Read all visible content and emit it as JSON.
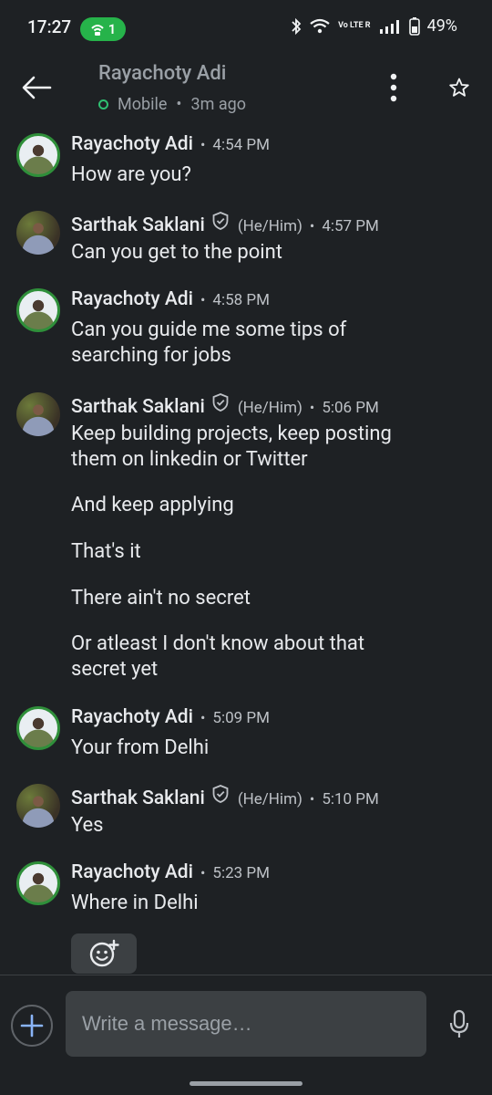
{
  "status_bar": {
    "time": "17:27",
    "hotspot_count": "1",
    "battery": "49%",
    "network_label": "Vo LTE R"
  },
  "header": {
    "contact_name": "Rayachoty Adi",
    "presence": "Mobile",
    "last_seen": "3m ago"
  },
  "messages": [
    {
      "sender": "Rayachoty Adi",
      "time": "4:54 PM",
      "lines": [
        "How are you?"
      ]
    },
    {
      "sender": "Sarthak Saklani",
      "pronouns": "(He/Him)",
      "time": "4:57 PM",
      "lines": [
        "Can you get to the point"
      ]
    },
    {
      "sender": "Rayachoty Adi",
      "time": "4:58 PM",
      "lines": [
        "Can you guide me some tips of searching for jobs"
      ]
    },
    {
      "sender": "Sarthak Saklani",
      "pronouns": "(He/Him)",
      "time": "5:06 PM",
      "lines": [
        "Keep building projects, keep posting them on linkedin or Twitter",
        "And keep applying",
        "That's it",
        "There ain't no secret",
        "Or atleast I don't know about that secret yet"
      ]
    },
    {
      "sender": "Rayachoty Adi",
      "time": "5:09 PM",
      "lines": [
        "Your from Delhi"
      ]
    },
    {
      "sender": "Sarthak Saklani",
      "pronouns": "(He/Him)",
      "time": "5:10 PM",
      "lines": [
        "Yes"
      ]
    },
    {
      "sender": "Rayachoty Adi",
      "time": "5:23 PM",
      "lines": [
        "Where in Delhi"
      ]
    }
  ],
  "composer": {
    "placeholder": "Write a message…"
  },
  "icons": {
    "back": "arrow-left-icon",
    "more": "more-vert-icon",
    "star": "star-outline-icon",
    "add": "plus-icon",
    "mic": "microphone-icon",
    "reaction": "add-reaction-icon",
    "verified": "verified-shield-icon"
  },
  "colors": {
    "background": "#1e2124",
    "accent_blue": "#8ab4f8",
    "presence_green": "#2fbf71",
    "hotspot_green": "#26b34a"
  }
}
